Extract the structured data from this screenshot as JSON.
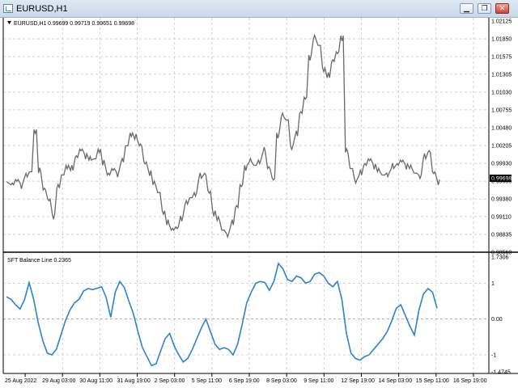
{
  "window": {
    "title": "EURUSD,H1",
    "buttons": {
      "minimize": "▁",
      "restore": "❐",
      "close": "✕"
    }
  },
  "chart": {
    "header": {
      "symbol": "EURUSD,H1",
      "ohlc": "0.99699 0.99719 0.99651 0.99698"
    },
    "price_scale": [
      "1.02125",
      "1.01850",
      "1.01575",
      "1.01305",
      "1.01030",
      "1.00755",
      "1.00480",
      "1.00205",
      "0.99930",
      "0.99655",
      "0.99380",
      "0.99110",
      "0.98835",
      "0.98560"
    ],
    "current_price": "0.99698",
    "indicator": {
      "name": "SFT Balance Line 0.2365",
      "scale_labels": [
        "1.7306",
        "1",
        "0.00",
        "-1",
        "-1.4745"
      ]
    },
    "time_labels": [
      "25 Aug 2022",
      "29 Aug 03:00",
      "30 Aug 11:00",
      "31 Aug 19:00",
      "2 Sep 03:00",
      "5 Sep 11:00",
      "6 Sep 19:00",
      "8 Sep 03:00",
      "9 Sep 11:00",
      "12 Sep 19:00",
      "14 Sep 03:00",
      "15 Sep 11:00",
      "16 Sep 19:00"
    ],
    "colors": {
      "price": "#6a6a6a",
      "indicator": "#2b83d1",
      "grid": "#c8c8c8"
    }
  },
  "chart_data": {
    "type": "line",
    "series": [
      {
        "values": [
          0.9965,
          0.996,
          0.9968,
          0.9962,
          0.9972,
          0.998,
          1.0045,
          0.9978,
          0.9952,
          0.9938,
          0.9915,
          0.9955,
          0.9975,
          0.999,
          0.9982,
          1.0002,
          1.0015,
          1.0008,
          0.9998,
          1.0,
          1.0015,
          0.999,
          0.9975,
          0.9985,
          0.998,
          0.9995,
          1.002,
          1.004,
          1.003,
          1.002,
          0.9995,
          0.9982,
          0.996,
          0.9948,
          0.992,
          0.9898,
          0.989,
          0.9895,
          0.9912,
          0.993,
          0.994,
          0.9948,
          0.997,
          0.9975,
          0.995,
          0.992,
          0.9905,
          0.989,
          0.9885,
          0.9898,
          0.9925,
          0.996,
          0.999,
          0.9995,
          0.999,
          0.9998,
          1.001,
          0.9985,
          0.997,
          1.004,
          1.0065,
          1.006,
          1.002,
          1.0035,
          1.007,
          1.0095,
          1.016,
          1.0185,
          1.0175,
          1.014,
          1.0125,
          1.015,
          1.0165,
          1.019,
          1.001,
          0.9985,
          0.9968,
          0.9975,
          0.999,
          1.0,
          0.9992,
          0.998,
          0.9975,
          0.9978,
          0.9985,
          0.999,
          0.9998,
          0.9992,
          0.9985,
          0.9978,
          0.9975,
          1.0,
          1.001,
          0.998,
          0.9968
        ]
      },
      {
        "name": "SFT Balance Line 0.2365",
        "values": [
          0.62,
          0.55,
          0.4,
          0.28,
          0.55,
          1.02,
          0.55,
          -0.1,
          -0.6,
          -0.95,
          -1.0,
          -0.85,
          -0.45,
          -0.05,
          0.25,
          0.45,
          0.55,
          0.78,
          0.85,
          0.82,
          0.86,
          0.9,
          0.6,
          0.05,
          0.75,
          1.05,
          0.88,
          0.5,
          0.15,
          -0.35,
          -0.8,
          -1.05,
          -1.3,
          -1.25,
          -0.9,
          -0.55,
          -0.4,
          -0.75,
          -1.0,
          -1.2,
          -1.1,
          -0.85,
          -0.55,
          -0.25,
          0.0,
          -0.35,
          -0.7,
          -0.85,
          -0.8,
          -0.85,
          -1.0,
          -0.7,
          -0.15,
          0.45,
          0.75,
          1.0,
          1.05,
          1.02,
          0.8,
          1.05,
          1.55,
          1.4,
          1.1,
          1.05,
          1.2,
          1.15,
          1.0,
          1.05,
          1.25,
          1.3,
          1.2,
          1.0,
          0.9,
          1.05,
          0.55,
          -0.4,
          -0.95,
          -1.1,
          -1.15,
          -1.05,
          -1.0,
          -0.85,
          -0.7,
          -0.55,
          -0.35,
          -0.05,
          0.3,
          0.4,
          0.1,
          -0.2,
          -0.45,
          0.25,
          0.7,
          0.85,
          0.75,
          0.3
        ]
      }
    ],
    "ylim": [
      0.9856,
      1.02125
    ],
    "indicator_ylim": [
      -1.4745,
      1.7306
    ]
  }
}
